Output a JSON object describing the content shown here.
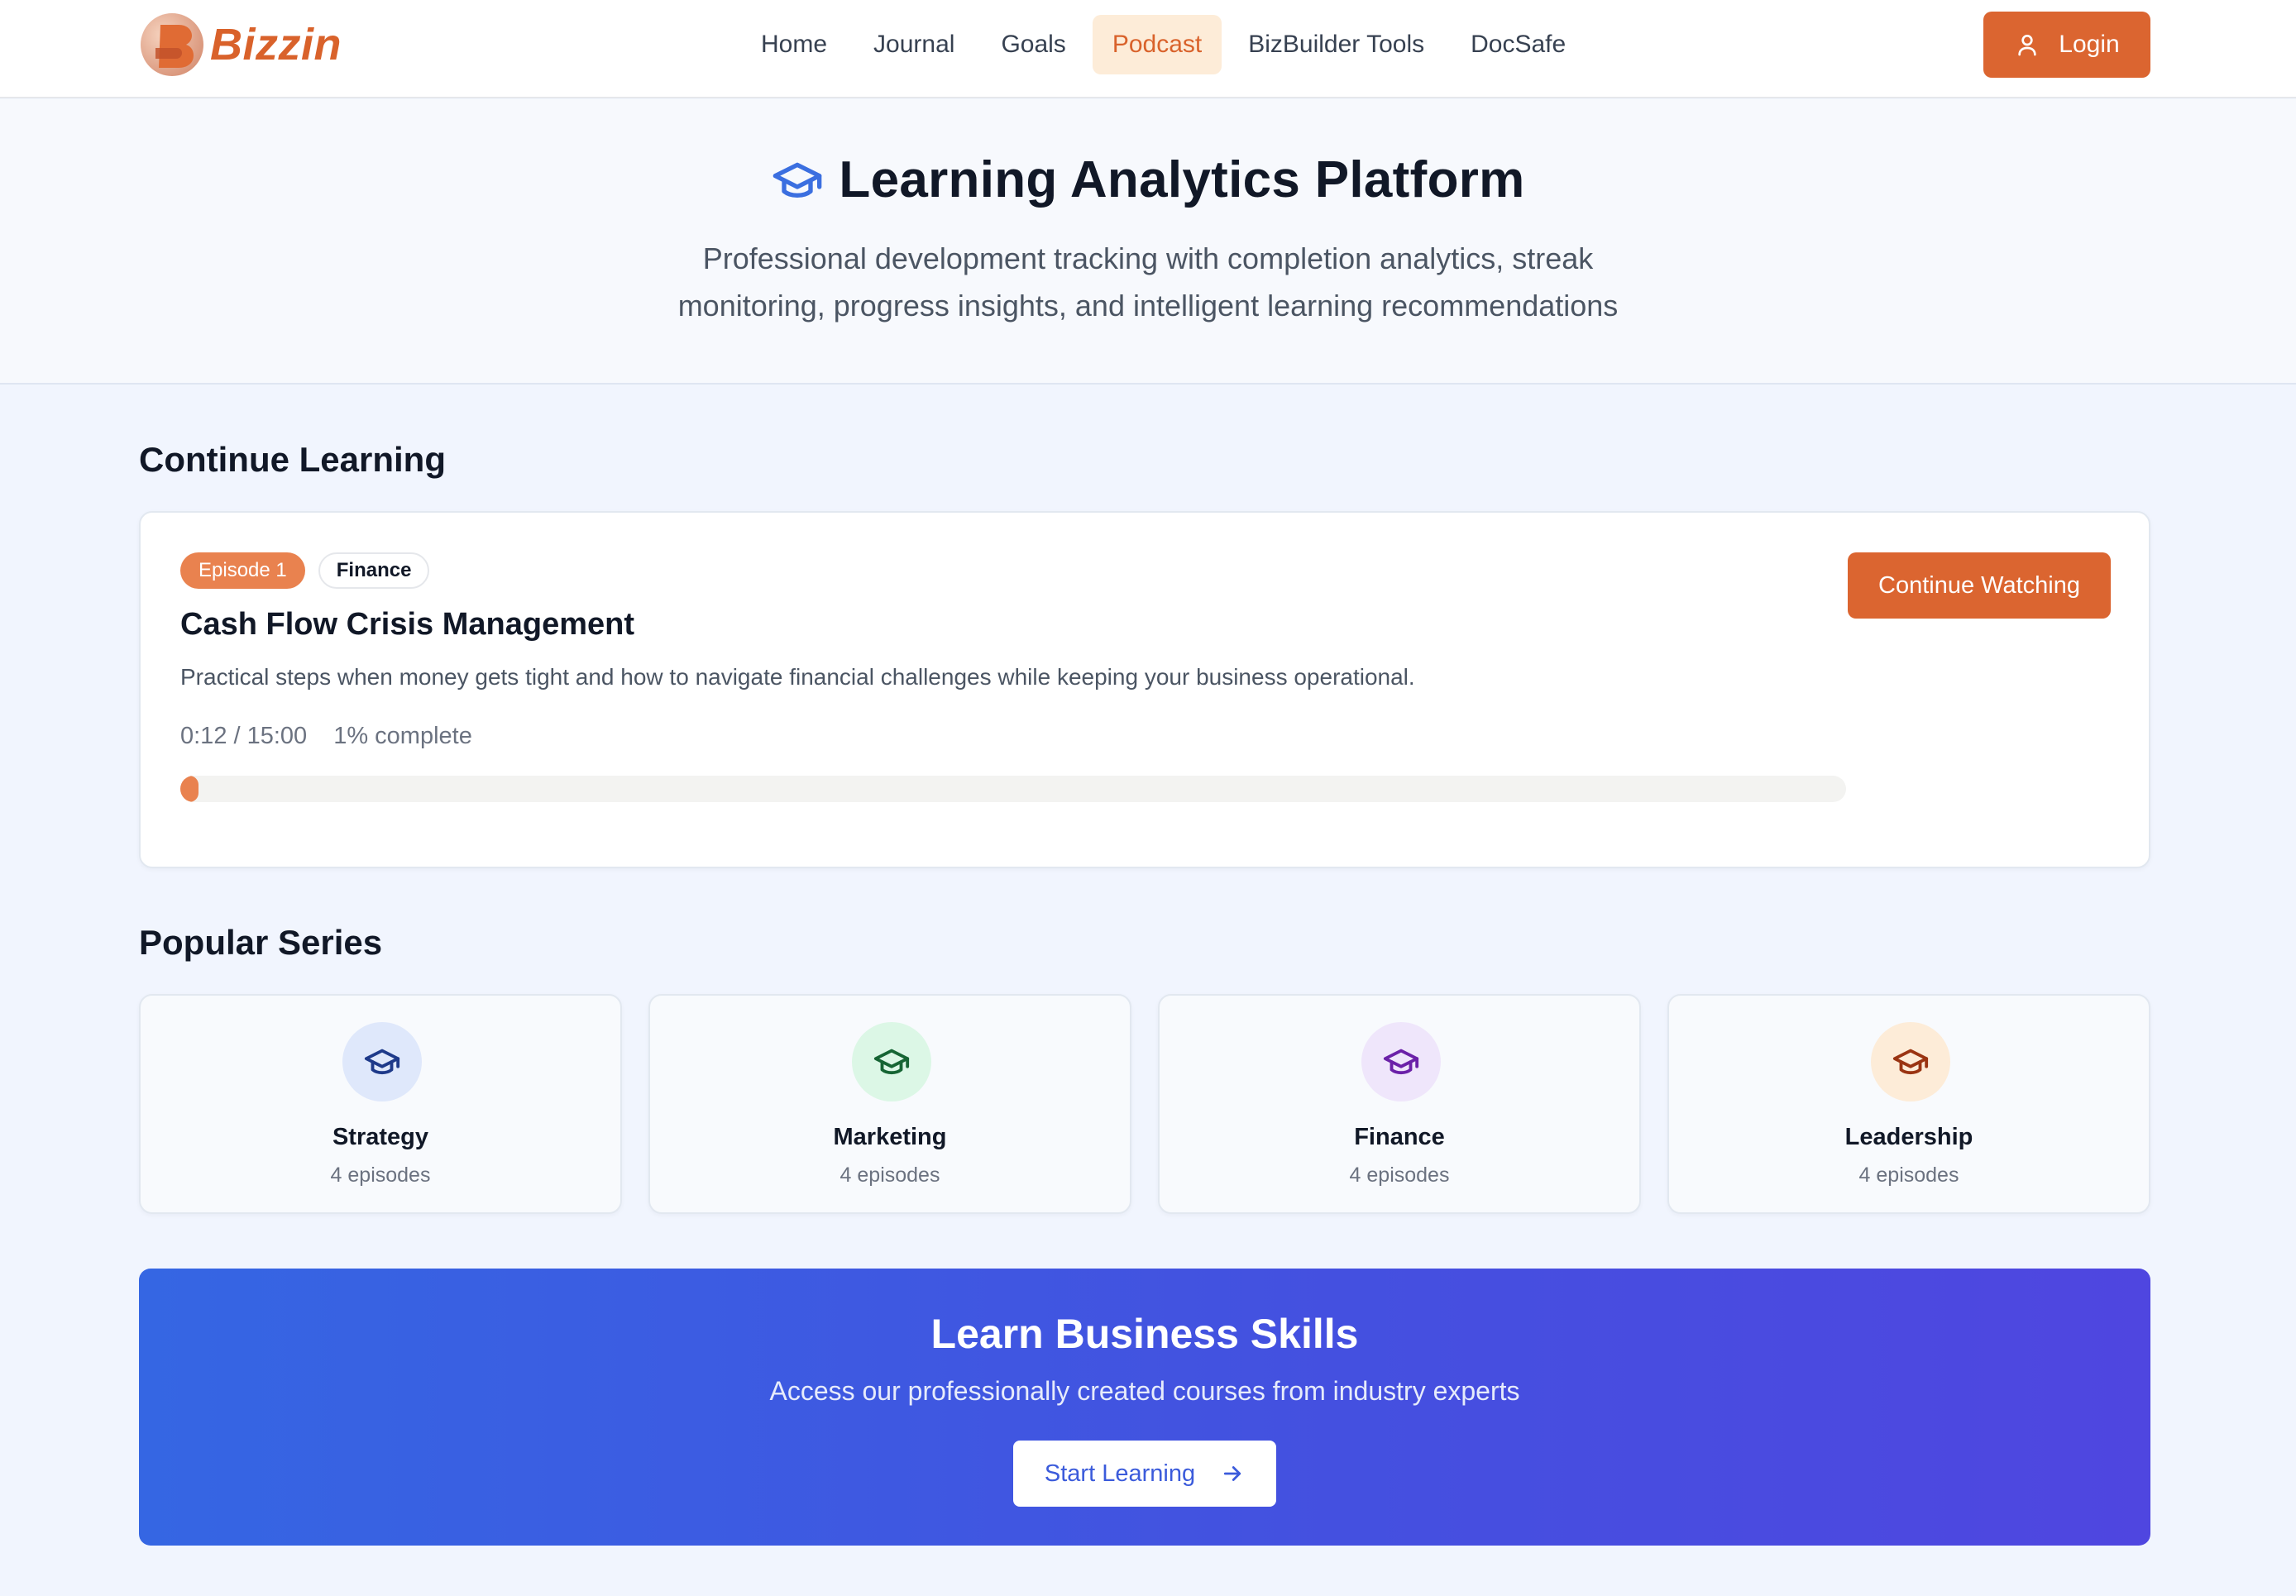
{
  "brand": {
    "name": "Bizzin",
    "color": "#d9622b"
  },
  "nav": {
    "items": [
      {
        "label": "Home",
        "active": false
      },
      {
        "label": "Journal",
        "active": false
      },
      {
        "label": "Goals",
        "active": false
      },
      {
        "label": "Podcast",
        "active": true
      },
      {
        "label": "BizBuilder Tools",
        "active": false
      },
      {
        "label": "DocSafe",
        "active": false
      }
    ],
    "login_label": "Login",
    "login_icon": "user-icon"
  },
  "hero": {
    "icon": "graduation-cap-icon",
    "title": "Learning Analytics Platform",
    "subtitle_line1": "Professional development tracking with completion analytics, streak",
    "subtitle_line2": "monitoring, progress insights, and intelligent learning recommendations"
  },
  "continue_learning": {
    "heading": "Continue Learning",
    "episode_badge": "Episode 1",
    "category_badge": "Finance",
    "title": "Cash Flow Crisis Management",
    "description": "Practical steps when money gets tight and how to navigate financial challenges while keeping your business operational.",
    "time": "0:12 / 15:00",
    "complete_text": "1% complete",
    "progress_percent": 1,
    "button_label": "Continue Watching"
  },
  "popular_series": {
    "heading": "Popular Series",
    "items": [
      {
        "name": "Strategy",
        "count": "4 episodes",
        "icon": "graduation-cap-icon",
        "bg": "#dfe8fb",
        "fg": "#1e3a8a"
      },
      {
        "name": "Marketing",
        "count": "4 episodes",
        "icon": "graduation-cap-icon",
        "bg": "#dcf7e6",
        "fg": "#166534"
      },
      {
        "name": "Finance",
        "count": "4 episodes",
        "icon": "graduation-cap-icon",
        "bg": "#efe6fb",
        "fg": "#6b21a8"
      },
      {
        "name": "Leadership",
        "count": "4 episodes",
        "icon": "graduation-cap-icon",
        "bg": "#fdecd8",
        "fg": "#9a3412"
      }
    ]
  },
  "cta": {
    "title": "Learn Business Skills",
    "subtitle": "Access our professionally created courses from industry experts",
    "button_label": "Start Learning",
    "button_icon": "arrow-right-icon"
  },
  "colors": {
    "accent": "#db6530",
    "accent_light": "#e9824f",
    "cta_blue": "#3566e3",
    "cta_indigo": "#4f46e0"
  }
}
